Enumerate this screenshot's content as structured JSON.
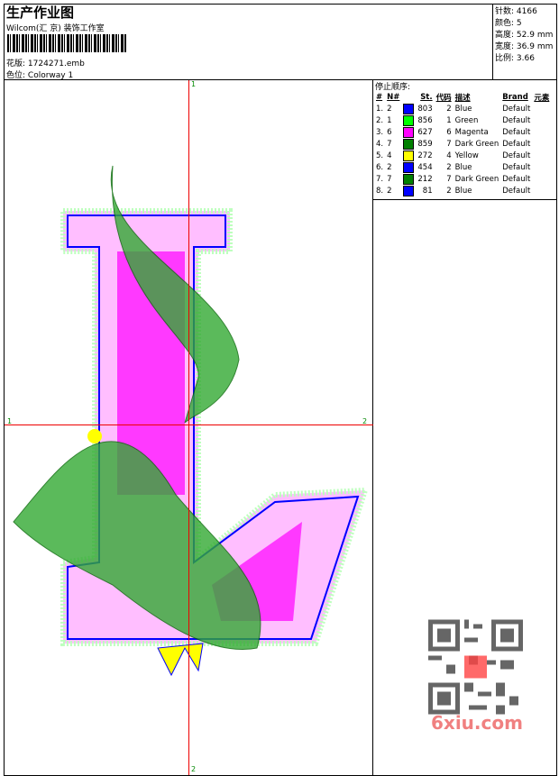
{
  "header": {
    "title": "生产作业图",
    "company": "Wilcom(汇 京) 装饰工作室",
    "design_label": "花版:",
    "design_file": "1724271.emb",
    "colorway_label": "色位:",
    "colorway": "Colorway 1"
  },
  "stats": [
    {
      "label": "针数:",
      "value": "4166"
    },
    {
      "label": "颜色:",
      "value": "5"
    },
    {
      "label": "高度:",
      "value": "52.9 mm"
    },
    {
      "label": "宽度:",
      "value": "36.9 mm"
    },
    {
      "label": "比例:",
      "value": "3.66"
    }
  ],
  "stop_sequence": {
    "title": "停止顺序:",
    "headers": [
      "#",
      "N#",
      "",
      "St.",
      "代码",
      "描述",
      "Brand",
      "元素"
    ],
    "rows": [
      {
        "idx": "1.",
        "n": "2",
        "color": "#0000ff",
        "st": "803",
        "code": "2",
        "desc": "Blue",
        "brand": "Default"
      },
      {
        "idx": "2.",
        "n": "1",
        "color": "#00ff00",
        "st": "856",
        "code": "1",
        "desc": "Green",
        "brand": "Default"
      },
      {
        "idx": "3.",
        "n": "6",
        "color": "#ff00ff",
        "st": "627",
        "code": "6",
        "desc": "Magenta",
        "brand": "Default"
      },
      {
        "idx": "4.",
        "n": "7",
        "color": "#008000",
        "st": "859",
        "code": "7",
        "desc": "Dark Green",
        "brand": "Default"
      },
      {
        "idx": "5.",
        "n": "4",
        "color": "#ffff00",
        "st": "272",
        "code": "4",
        "desc": "Yellow",
        "brand": "Default"
      },
      {
        "idx": "6.",
        "n": "2",
        "color": "#0000ff",
        "st": "454",
        "code": "2",
        "desc": "Blue",
        "brand": "Default"
      },
      {
        "idx": "7.",
        "n": "7",
        "color": "#008000",
        "st": "212",
        "code": "7",
        "desc": "Dark Green",
        "brand": "Default"
      },
      {
        "idx": "8.",
        "n": "2",
        "color": "#0000ff",
        "st": "81",
        "code": "2",
        "desc": "Blue",
        "brand": "Default"
      }
    ]
  },
  "axes": {
    "top": "1",
    "bottom": "2",
    "left": "1",
    "right": "2"
  },
  "watermark": "6xiu.com"
}
